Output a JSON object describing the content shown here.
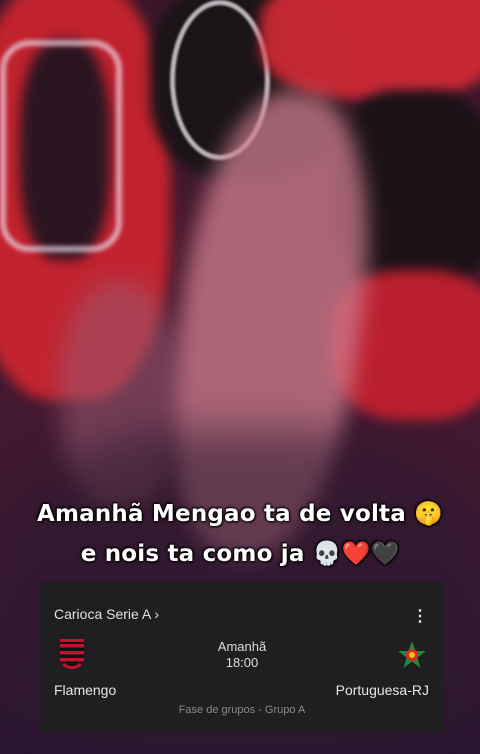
{
  "caption": {
    "line1": "Amanhã Mengao ta de volta 🤫",
    "line2": "e nois ta como ja 💀❤️🖤"
  },
  "match": {
    "league": "Carioca Serie A ›",
    "day": "Amanhã",
    "time": "18:00",
    "home_team": "Flamengo",
    "away_team": "Portuguesa-RJ",
    "phase": "Fase de grupos - Grupo A"
  },
  "colors": {
    "flamengo_red": "#c8102e",
    "flamengo_black": "#111111",
    "portuguesa_green": "#1f8a3b",
    "card_bg": "#1f1f21"
  },
  "icons": [
    "more-vert-icon",
    "flamengo-crest-icon",
    "portuguesa-crest-icon"
  ]
}
